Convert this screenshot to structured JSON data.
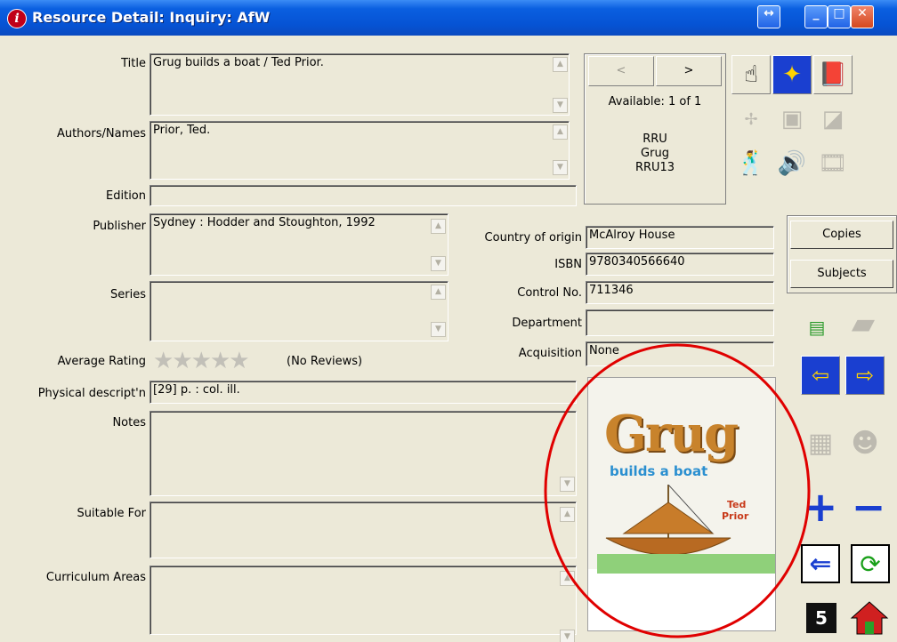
{
  "window": {
    "title": "Resource Detail: Inquiry: AfW"
  },
  "labels": {
    "title": "Title",
    "authors": "Authors/Names",
    "edition": "Edition",
    "publisher": "Publisher",
    "series": "Series",
    "average_rating": "Average Rating",
    "physical": "Physical descript'n",
    "notes": "Notes",
    "suitable_for": "Suitable For",
    "curriculum": "Curriculum Areas",
    "country": "Country of origin",
    "isbn": "ISBN",
    "control_no": "Control No.",
    "department": "Department",
    "acquisition": "Acquisition"
  },
  "values": {
    "title": "Grug builds a boat / Ted Prior.",
    "authors": "Prior, Ted.",
    "edition": "",
    "publisher": "Sydney : Hodder and Stoughton, 1992",
    "series": "",
    "rating_stars": 0,
    "rating_text": "(No Reviews)",
    "physical": "[29] p. : col. ill.",
    "notes": "",
    "suitable_for": "",
    "curriculum": "",
    "country": "McAlroy House",
    "isbn": "9780340566640",
    "control_no": "711346",
    "department": "",
    "acquisition": "None"
  },
  "availability": {
    "prev": "<",
    "next": ">",
    "status": "Available: 1 of 1",
    "line1": "RRU",
    "line2": "Grug",
    "line3": "RRU13"
  },
  "buttons": {
    "copies": "Copies",
    "subjects": "Subjects"
  },
  "cover": {
    "title": "Grug",
    "subtitle": "builds a boat",
    "author_first": "Ted",
    "author_last": "Prior"
  },
  "toolbar": {
    "count_badge": "5"
  },
  "colors": {
    "titlebar": "#0653d4",
    "annotation_circle": "#e00000",
    "accent_blue": "#1a3fd0"
  }
}
